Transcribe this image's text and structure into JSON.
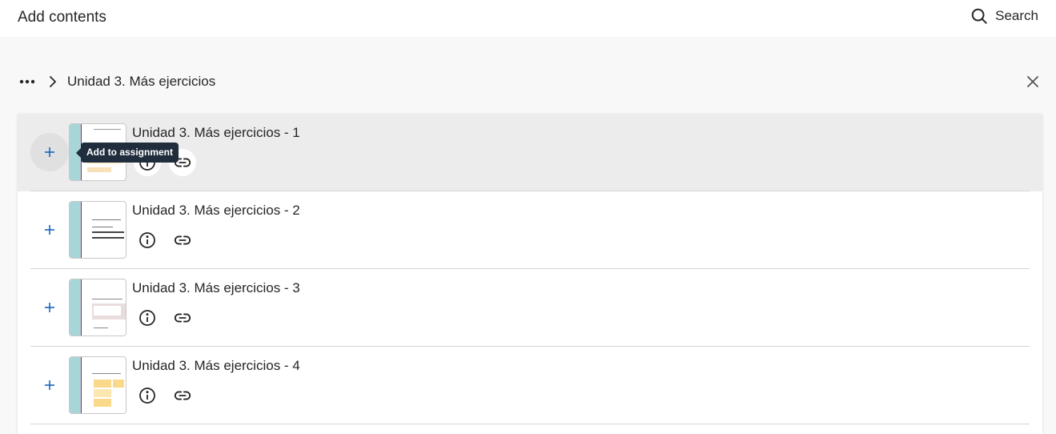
{
  "header": {
    "title": "Add contents",
    "search_label": "Search",
    "search_icon": "search-icon"
  },
  "breadcrumb": {
    "more_icon": "more-horizontal-icon",
    "separator_icon": "chevron-right-icon",
    "current": "Unidad 3. Más ejercicios"
  },
  "close_icon": "close-icon",
  "tooltip": "Add to assignment",
  "items": [
    {
      "title": "Unidad 3. Más ejercicios - 1",
      "add_icon": "plus-icon",
      "info_icon": "info-icon",
      "link_icon": "link-icon"
    },
    {
      "title": "Unidad 3. Más ejercicios - 2",
      "add_icon": "plus-icon",
      "info_icon": "info-icon",
      "link_icon": "link-icon"
    },
    {
      "title": "Unidad 3. Más ejercicios - 3",
      "add_icon": "plus-icon",
      "info_icon": "info-icon",
      "link_icon": "link-icon"
    },
    {
      "title": "Unidad 3. Más ejercicios - 4",
      "add_icon": "plus-icon",
      "info_icon": "info-icon",
      "link_icon": "link-icon"
    }
  ],
  "colors": {
    "accent": "#1565c0",
    "hover_row": "#ececec",
    "tooltip_bg": "#1f2d3d",
    "thumbnail_band": "#a8d5d8"
  }
}
